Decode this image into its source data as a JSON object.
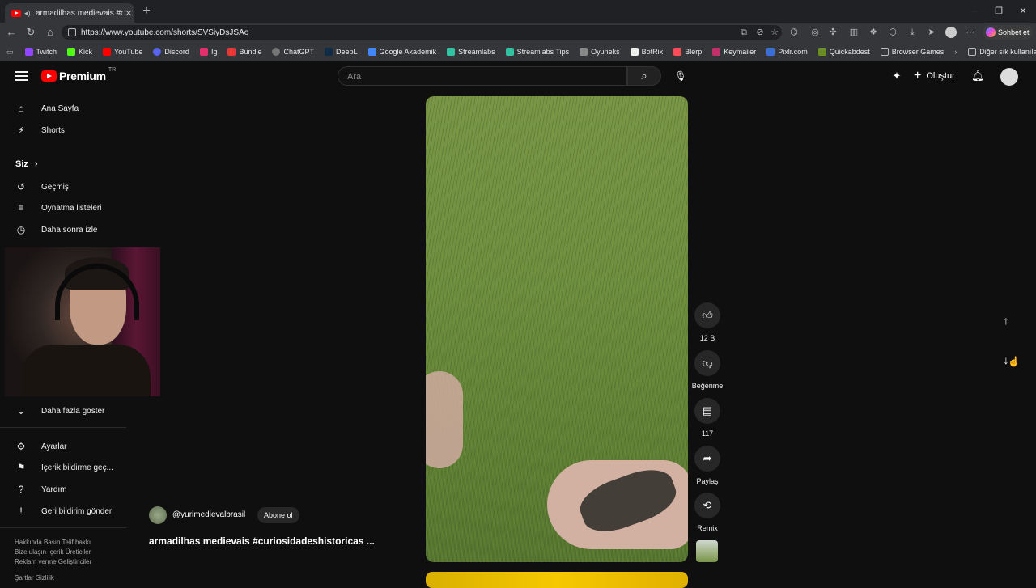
{
  "browser": {
    "tab_title": "armadilhas medievais #curios",
    "url": "https://www.youtube.com/shorts/SVSiyDsJSAo",
    "sohbet_label": "Sohbet et",
    "bookmarks": [
      "Twitch",
      "Kick",
      "YouTube",
      "Discord",
      "Ig",
      "Bundle",
      "ChatGPT",
      "DeepL",
      "Google Akademik",
      "Streamlabs",
      "Streamlabs Tips",
      "Oyuneks",
      "BotRix",
      "Blerp",
      "Keymailer",
      "Pixlr.com",
      "Quickabdest",
      "Browser Games"
    ],
    "other_bookmarks": "Diğer sık kullanılanlar"
  },
  "youtube": {
    "logo_text": "Premium",
    "country_code": "TR",
    "search_placeholder": "Ara",
    "create_label": "Oluştur"
  },
  "sidebar": {
    "home": "Ana Sayfa",
    "shorts": "Shorts",
    "you_section": "Siz",
    "history": "Geçmiş",
    "playlists": "Oynatma listeleri",
    "watch_later": "Daha sonra izle",
    "show_more": "Daha fazla göster",
    "settings": "Ayarlar",
    "report": "İçerik bildirme geç...",
    "help": "Yardım",
    "feedback": "Geri bildirim gönder",
    "footer_line1": "Hakkında  Basın  Telif hakkı",
    "footer_line2": "Bize ulaşın  İçerik Üreticiler",
    "footer_line3": "Reklam verme  Geliştiriciler",
    "footer_line4": "Şartlar  Gizlilik"
  },
  "short": {
    "channel": "@yurimedievalbrasil",
    "subscribe": "Abone ol",
    "title": "armadilhas medievais #curiosidadeshistoricas ...",
    "likes": "12 B",
    "dislike": "Beğenme",
    "comments": "117",
    "share": "Paylaş",
    "remix": "Remix"
  }
}
